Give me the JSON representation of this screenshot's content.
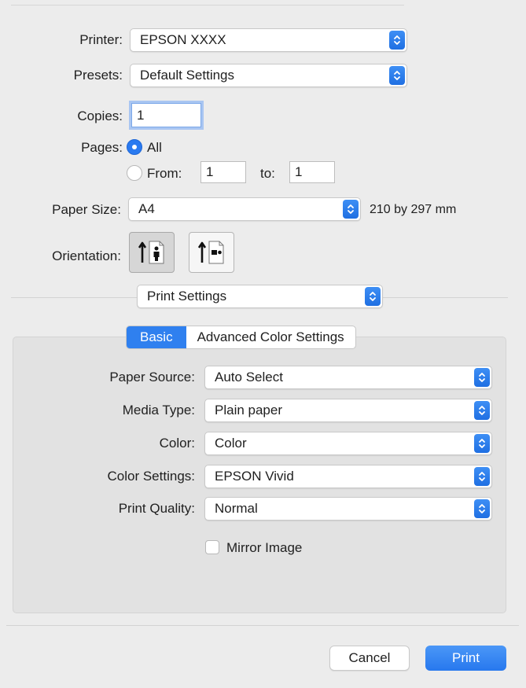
{
  "printer": {
    "label": "Printer:",
    "value": "EPSON XXXX"
  },
  "presets": {
    "label": "Presets:",
    "value": "Default Settings"
  },
  "copies": {
    "label": "Copies:",
    "value": "1"
  },
  "pages": {
    "label": "Pages:",
    "all_label": "All",
    "from_label": "From:",
    "from_value": "1",
    "to_label": "to:",
    "to_value": "1",
    "selected": "All"
  },
  "paper_size": {
    "label": "Paper Size:",
    "value": "A4",
    "dimensions": "210 by 297 mm"
  },
  "orientation": {
    "label": "Orientation:",
    "selected": "portrait",
    "options": [
      "portrait-icon",
      "landscape-icon"
    ]
  },
  "section_popup": {
    "value": "Print Settings"
  },
  "tabs": {
    "basic": "Basic",
    "advanced": "Advanced Color Settings",
    "active": "Basic"
  },
  "settings": {
    "paper_source": {
      "label": "Paper Source:",
      "value": "Auto Select"
    },
    "media_type": {
      "label": "Media Type:",
      "value": "Plain paper"
    },
    "color": {
      "label": "Color:",
      "value": "Color"
    },
    "color_settings": {
      "label": "Color Settings:",
      "value": "EPSON Vivid"
    },
    "print_quality": {
      "label": "Print Quality:",
      "value": "Normal"
    },
    "mirror_image": {
      "label": "Mirror Image",
      "checked": false
    }
  },
  "buttons": {
    "cancel": "Cancel",
    "print": "Print"
  },
  "colors": {
    "accent": "#2a7af0",
    "background": "#ececec",
    "panel": "#e2e2e2"
  }
}
